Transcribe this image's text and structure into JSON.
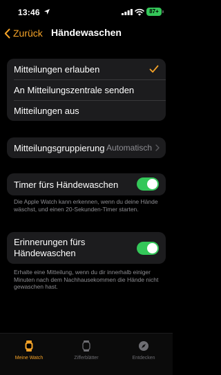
{
  "status_bar": {
    "time": "13:46",
    "battery": "87+"
  },
  "nav": {
    "back_label": "Zurück",
    "title": "Händewaschen"
  },
  "notifications": {
    "options": [
      {
        "label": "Mitteilungen erlauben",
        "selected": true
      },
      {
        "label": "An Mitteilungszentrale senden",
        "selected": false
      },
      {
        "label": "Mitteilungen aus",
        "selected": false
      }
    ]
  },
  "grouping": {
    "label": "Mitteilungsgruppierung",
    "value": "Automatisch"
  },
  "timer": {
    "label": "Timer fürs Händewaschen",
    "on": true,
    "footnote": "Die Apple Watch kann erkennen, wenn du deine Hände wäschst, und einen 20-Sekunden-Timer starten."
  },
  "reminders": {
    "label": "Erinnerungen fürs Händewaschen",
    "on": true,
    "footnote": "Erhalte eine Mitteilung, wenn du dir innerhalb einiger Minuten nach dem Nachhausekommen die Hände nicht gewaschen hast."
  },
  "tabbar": {
    "tabs": [
      {
        "label": "Meine Watch",
        "icon": "watch-icon",
        "active": true
      },
      {
        "label": "Zifferblätter",
        "icon": "watch-face-icon",
        "active": false
      },
      {
        "label": "Entdecken",
        "icon": "compass-icon",
        "active": false
      }
    ]
  },
  "colors": {
    "accent": "#f5a328",
    "toggle_on": "#34c759",
    "cell_bg": "#1c1c1e",
    "background": "#000000"
  }
}
